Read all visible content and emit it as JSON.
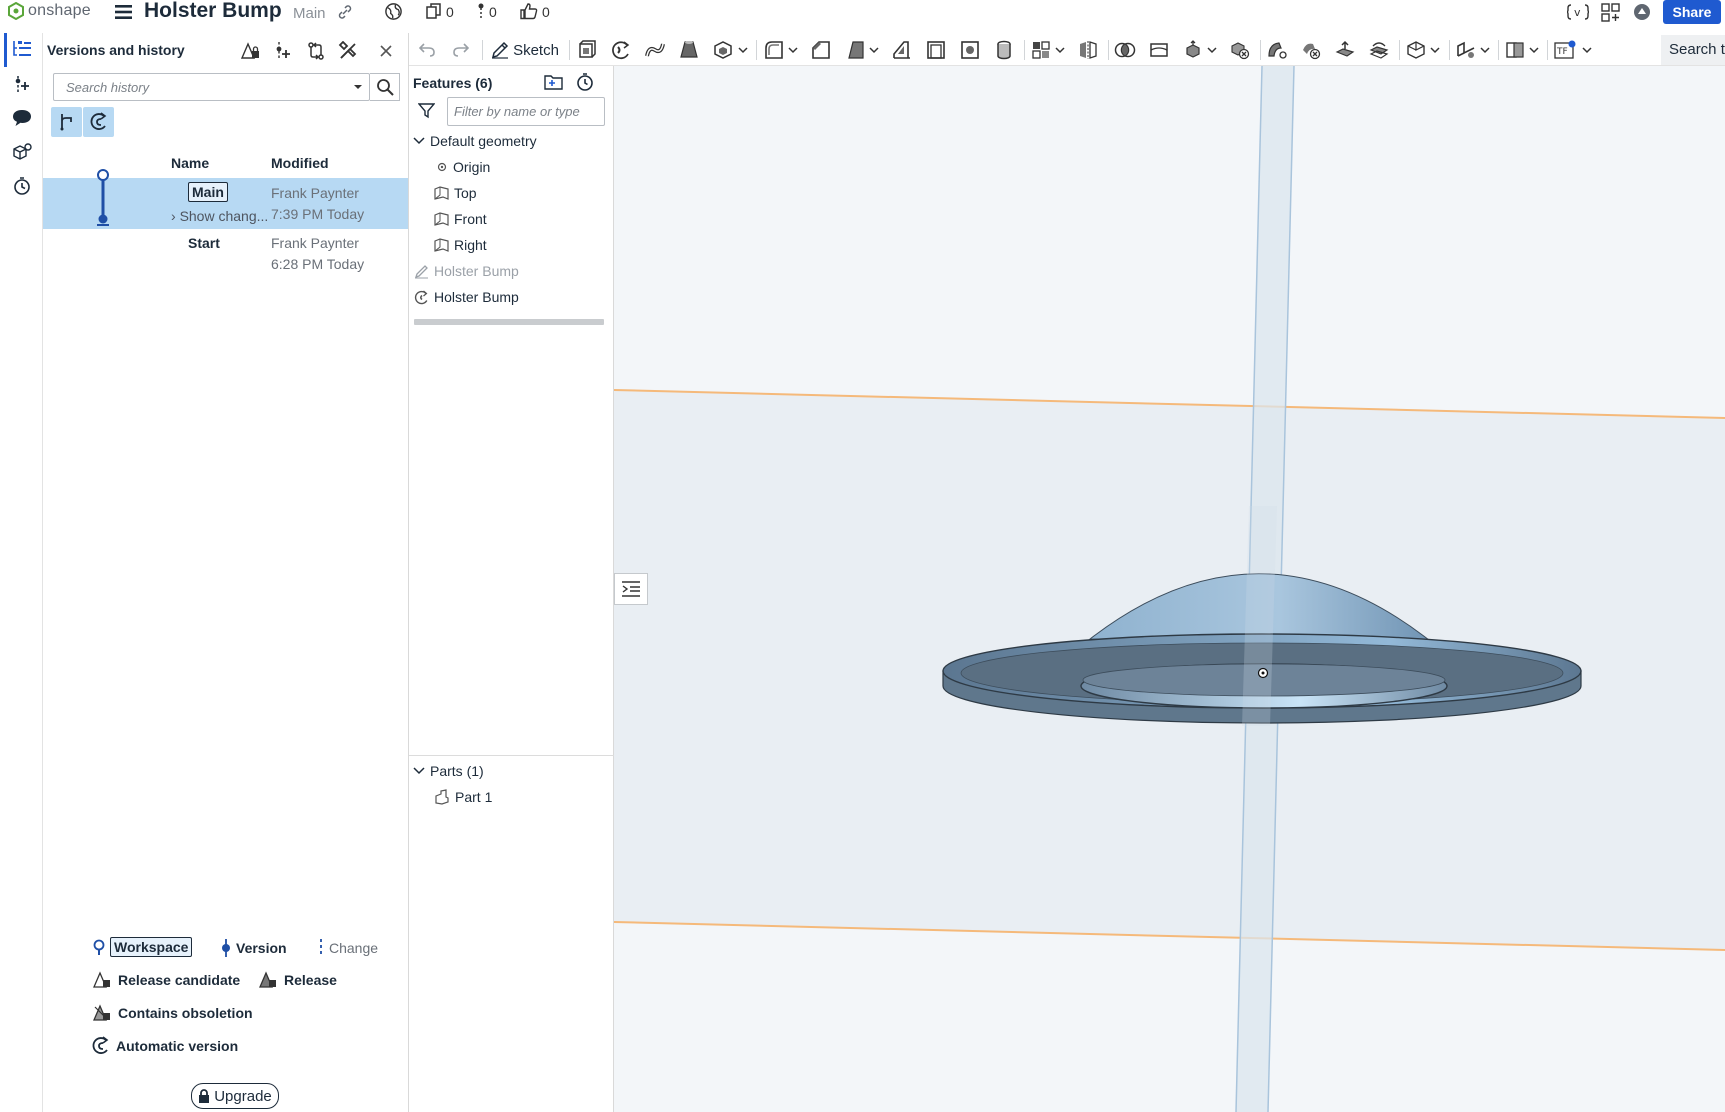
{
  "header": {
    "logo_text": "onshape",
    "doc_title": "Holster Bump",
    "branch": "Main",
    "counters": [
      "0",
      "0",
      "0"
    ],
    "share_label": "Share"
  },
  "versions_panel": {
    "title": "Versions and history",
    "search_placeholder": "Search history",
    "columns": {
      "name": "Name",
      "modified": "Modified"
    },
    "rows": [
      {
        "name": "Main",
        "sub": "Show chang...",
        "author": "Frank Paynter",
        "time": "7:39 PM Today"
      },
      {
        "name": "Start",
        "author": "Frank Paynter",
        "time": "6:28 PM Today"
      }
    ],
    "legend": {
      "workspace": "Workspace",
      "version": "Version",
      "change": "Change",
      "release_candidate": "Release candidate",
      "release": "Release",
      "obsolete": "Contains obsoletion",
      "auto_version": "Automatic version"
    },
    "upgrade_label": "Upgrade"
  },
  "toolbar": {
    "sketch_label": "Sketch",
    "search_tools_label": "Search to"
  },
  "feature_panel": {
    "title": "Features (6)",
    "filter_placeholder": "Filter by name or type",
    "default_geometry_label": "Default geometry",
    "items": [
      "Origin",
      "Top",
      "Front",
      "Right"
    ],
    "sketch_feature": "Holster Bump",
    "revolve_feature": "Holster Bump",
    "parts_label": "Parts (1)",
    "parts": [
      "Part 1"
    ]
  },
  "colors": {
    "accent": "#1f5ad0",
    "selection": "#b7d9f3",
    "plane_edge": "#f5b97a",
    "part": "#7e9fbb",
    "viewport_bg": "#f3f6f9"
  }
}
